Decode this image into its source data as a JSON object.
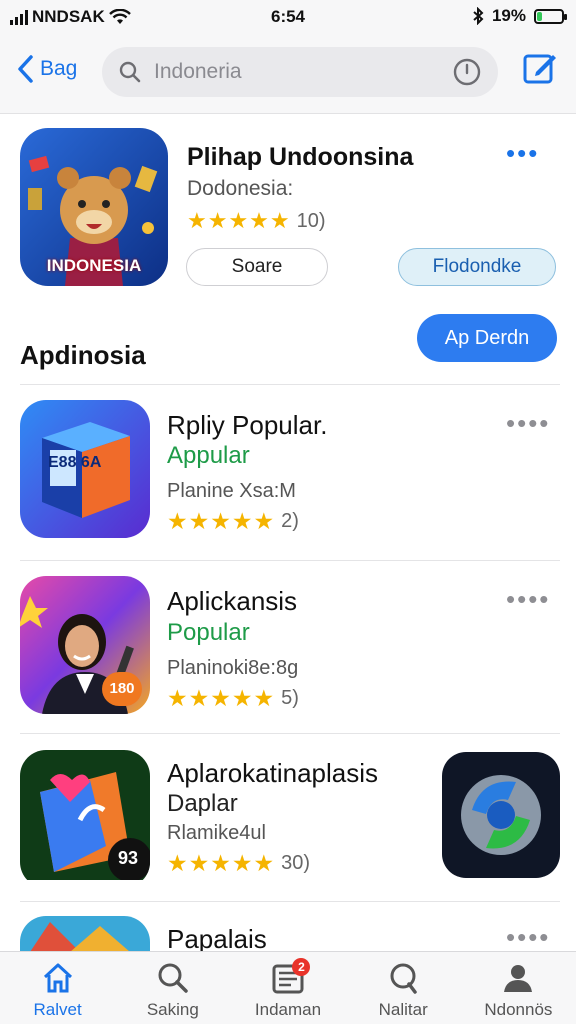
{
  "status_bar": {
    "carrier": "NNDSAK",
    "time": "6:54",
    "battery": "19%",
    "battery_level": 0.19
  },
  "nav": {
    "back_label": "Bag",
    "search_value": "Indoneria"
  },
  "featured": {
    "title": "Plihap Undoonsina",
    "subtitle": "Dodonesia:",
    "stars": "★★★★★",
    "rating_count": "10)",
    "icon_caption": "INDONESIA",
    "share_button": "Soare",
    "get_button": "Flodondke",
    "more": "•••"
  },
  "section": {
    "title": "Apdinosia",
    "button": "Ap Derdn"
  },
  "apps": [
    {
      "name": "Rpliy Popular.",
      "category": "Appular",
      "info": "Planine Xsa:M",
      "stars": "★★★★★",
      "rating_count": "2)",
      "icon_text": "E88 6A",
      "more": "••••"
    },
    {
      "name": "Aplickansis",
      "category": "Popular",
      "info": "Planinoki8e:8g",
      "stars": "★★★★★",
      "rating_count": "5)",
      "icon_text": "180",
      "more": "••••"
    },
    {
      "name": "Aplarokatinaplasis",
      "category": "Daplar",
      "info": "Rlamike4ul",
      "stars": "★★★★★",
      "rating_count": "30)",
      "icon_text": "93",
      "more": ""
    },
    {
      "name": "Papalais",
      "more": "••••"
    }
  ],
  "tabs": [
    {
      "label": "Ralvet"
    },
    {
      "label": "Saking"
    },
    {
      "label": "Indaman",
      "badge": "2"
    },
    {
      "label": "Nalitar"
    },
    {
      "label": "Ndonnös"
    }
  ],
  "colors": {
    "accent": "#1a73e8",
    "star": "#f5b400",
    "category_green": "#1e9b48",
    "badge": "#e8332a"
  }
}
